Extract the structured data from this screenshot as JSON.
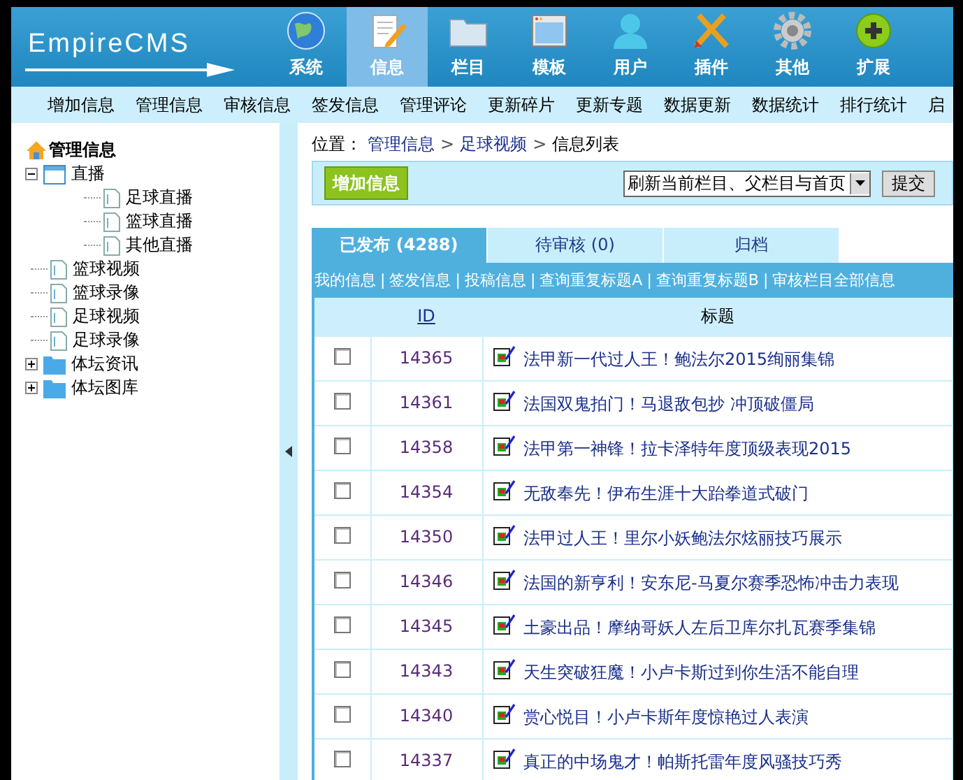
{
  "header": {
    "logo": "EmpireCMS",
    "modules": [
      {
        "label": "系统",
        "selected": false
      },
      {
        "label": "信息",
        "selected": true
      },
      {
        "label": "栏目",
        "selected": false
      },
      {
        "label": "模板",
        "selected": false
      },
      {
        "label": "用户",
        "selected": false
      },
      {
        "label": "插件",
        "selected": false
      },
      {
        "label": "其他",
        "selected": false
      },
      {
        "label": "扩展",
        "selected": false
      }
    ]
  },
  "submenu": [
    "增加信息",
    "管理信息",
    "审核信息",
    "签发信息",
    "管理评论",
    "更新碎片",
    "更新专题",
    "数据更新",
    "数据统计",
    "排行统计",
    "启"
  ],
  "sidebar": {
    "title": "管理信息",
    "tree": [
      {
        "label": "直播",
        "kind": "channel",
        "expanded": true,
        "children": [
          {
            "label": "足球直播",
            "kind": "page"
          },
          {
            "label": "篮球直播",
            "kind": "page"
          },
          {
            "label": "其他直播",
            "kind": "page"
          }
        ]
      },
      {
        "label": "篮球视频",
        "kind": "page"
      },
      {
        "label": "篮球录像",
        "kind": "page"
      },
      {
        "label": "足球视频",
        "kind": "page"
      },
      {
        "label": "足球录像",
        "kind": "page"
      },
      {
        "label": "体坛资讯",
        "kind": "folder",
        "expanded": false
      },
      {
        "label": "体坛图库",
        "kind": "folder",
        "expanded": false
      }
    ]
  },
  "breadcrumb": {
    "label": "位置：",
    "links": [
      "管理信息",
      "足球视频"
    ],
    "current": "信息列表",
    "separator": ">"
  },
  "toolbar": {
    "add_button": "增加信息",
    "refresh_select": "刷新当前栏目、父栏目与首页",
    "submit_button": "提交"
  },
  "tabs": [
    {
      "label": "已发布 (4288)",
      "selected": true
    },
    {
      "label": "待审核 (0)",
      "selected": false
    },
    {
      "label": "归档",
      "selected": false
    }
  ],
  "filter_separator": "|",
  "filter_links": [
    "我的信息",
    "签发信息",
    "投稿信息",
    "查询重复标题A",
    "查询重复标题B",
    "审核栏目全部信息"
  ],
  "table": {
    "columns": [
      "ID",
      "标题"
    ],
    "rows": [
      {
        "checked": false,
        "id": "14365",
        "title": "法甲新一代过人王！鲍法尔2015绚丽集锦"
      },
      {
        "checked": false,
        "id": "14361",
        "title": "法国双鬼拍门！马退敌包抄 冲顶破僵局"
      },
      {
        "checked": false,
        "id": "14358",
        "title": "法甲第一神锋！拉卡泽特年度顶级表现2015"
      },
      {
        "checked": false,
        "id": "14354",
        "title": "无敌奉先！伊布生涯十大跆拳道式破门"
      },
      {
        "checked": false,
        "id": "14350",
        "title": "法甲过人王！里尔小妖鲍法尔炫丽技巧展示"
      },
      {
        "checked": false,
        "id": "14346",
        "title": "法国的新亨利！安东尼-马夏尔赛季恐怖冲击力表现"
      },
      {
        "checked": false,
        "id": "14345",
        "title": "土豪出品！摩纳哥妖人左后卫库尔扎瓦赛季集锦"
      },
      {
        "checked": false,
        "id": "14343",
        "title": "天生突破狂魔！小卢卡斯过到你生活不能自理"
      },
      {
        "checked": false,
        "id": "14340",
        "title": "赏心悦目！小卢卡斯年度惊艳过人表演"
      },
      {
        "checked": false,
        "id": "14337",
        "title": "真正的中场鬼才！帕斯托雷年度风骚技巧秀"
      }
    ]
  }
}
